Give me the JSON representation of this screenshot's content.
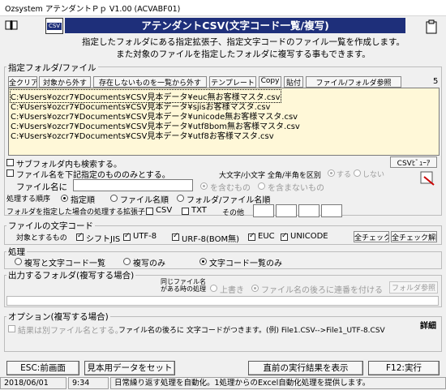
{
  "window": {
    "title": "Ozsystem アテンダントＰｐ V1.00 (ACVABF01)"
  },
  "header": {
    "title": "アテンダントCSV(文字コード一覧/複写)",
    "desc1": "指定したフォルダにある指定拡張子、指定文字コードのファイル一覧を作成します。",
    "desc2": "また対象のファイルを指定したフォルダに複写する事もできます。",
    "csv_icon": "CSV"
  },
  "folder_group": {
    "label": "指定フォルダ/ファイル",
    "count": "5",
    "toolbar": [
      "全クリア",
      "対象から外す",
      "存在しないものを一覧から外す",
      "テンプレート",
      "Copy",
      "貼付",
      "ファイル/フォルダ参照"
    ],
    "files": [
      "C:¥Users¥ozcr7¥Documents¥CSV見本データ¥euc無お客様マスタ.csv",
      "C:¥Users¥ozcr7¥Documents¥CSV見本データ¥sjisお客様マスタ.csv",
      "C:¥Users¥ozcr7¥Documents¥CSV見本データ¥unicode無お客様マスタ.csv",
      "C:¥Users¥ozcr7¥Documents¥CSV見本データ¥utf8bom無お客様マスタ.csv",
      "C:¥Users¥ozcr7¥Documents¥CSV見本データ¥utf8お客様マスタ.csv"
    ],
    "subfolder": "サブフォルダ内も検索する。",
    "name_filter": "ファイル名を下記指定のもののみとする。",
    "csv_viewer": "CSVﾋﾞｭｰｱ",
    "case_label": "大文字/小文字 全角/半角を区別",
    "case_yes": "する",
    "case_no": "しない",
    "filename_label": "ファイル名に",
    "contains": "を含むもの",
    "not_contains": "を含まないもの",
    "order_label": "処理する順序",
    "order_opts": [
      "指定順",
      "ファイル名順",
      "フォルダ/ファイル名順"
    ],
    "ext_label": "フォルダを指定した場合の処理する拡張子",
    "ext_csv": "CSV",
    "ext_txt": "TXT",
    "ext_other": "その他"
  },
  "encoding_group": {
    "label": "ファイルの文字コード",
    "target_label": "対象とするもの",
    "items": [
      "シフトJIS",
      "UTF-8",
      "URF-8(BOM無)",
      "EUC",
      "UNICODE"
    ],
    "all_check": "全チェック",
    "all_uncheck": "全チェック解除"
  },
  "process_group": {
    "label": "処理",
    "opts": [
      "複写と文字コード一覧",
      "複写のみ",
      "文字コード一覧のみ"
    ]
  },
  "output_group": {
    "label": "出力するフォルダ(複写する場合)",
    "same_name_1": "同じファイル名",
    "same_name_2": "がある時の処理",
    "overwrite": "上書き",
    "append_seq": "ファイル名の後ろに連番を付ける",
    "folder_ref": "フォルダ参照"
  },
  "option_group": {
    "label": "オプション(複写する場合)",
    "separate": "結果は別ファイル名とする。",
    "note": "ファイル名の後ろに 文字コードがつきます。(例) File1.CSV-->File1_UTF-8.CSV",
    "detail": "詳細"
  },
  "footer": {
    "esc": "ESC:前画面",
    "sample": "見本用データをセット",
    "last_result": "直前の実行結果を表示",
    "f12": "F12:実行"
  },
  "status": {
    "date": "2018/06/01",
    "time": "9:34",
    "message": "日常繰り返す処理を自動化。1処理からのExcel自動化処理を提供します。"
  }
}
